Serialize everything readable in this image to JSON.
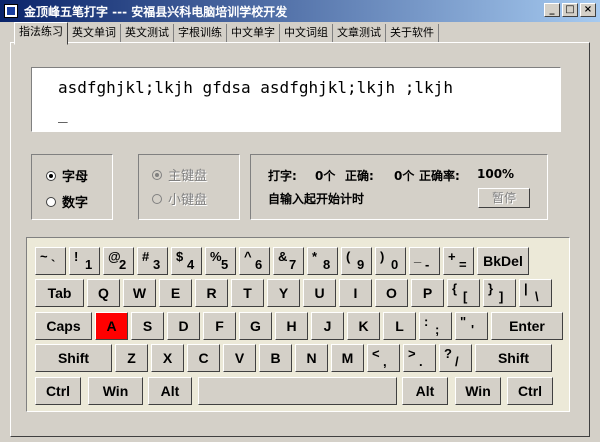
{
  "window": {
    "title": "金顶峰五笔打字 --- 安福县兴科电脑培训学校开发"
  },
  "tabs": [
    {
      "label": "指法练习",
      "active": true
    },
    {
      "label": "英文单词",
      "active": false
    },
    {
      "label": "英文测试",
      "active": false
    },
    {
      "label": "字根训练",
      "active": false
    },
    {
      "label": "中文单字",
      "active": false
    },
    {
      "label": "中文词组",
      "active": false
    },
    {
      "label": "文章测试",
      "active": false
    },
    {
      "label": "关于软件",
      "active": false
    }
  ],
  "practice": {
    "text": "asdfghjkl;lkjh gfdsa asdfghjkl;lkjh ;lkjh",
    "cursor": "_"
  },
  "mode": {
    "letters": "字母",
    "digits": "数字",
    "selected": "letters"
  },
  "keypad": {
    "main": "主键盘",
    "small": "小键盘"
  },
  "stats": {
    "typed_label": "打字:",
    "typed_value": "0个",
    "correct_label": "正确:",
    "correct_value": "0个",
    "rate_label": "正确率:",
    "rate_value": "100%",
    "auto_timer": "自输入起开始计时",
    "pause_label": "暂停"
  },
  "keyboard": {
    "highlight_color": "#ff0000",
    "rows": [
      [
        {
          "s": "~",
          "b": "`"
        },
        {
          "s": "!",
          "b": "1"
        },
        {
          "s": "@",
          "b": "2"
        },
        {
          "s": "#",
          "b": "3"
        },
        {
          "s": "$",
          "b": "4"
        },
        {
          "s": "%",
          "b": "5"
        },
        {
          "s": "^",
          "b": "6"
        },
        {
          "s": "&",
          "b": "7"
        },
        {
          "s": "*",
          "b": "8"
        },
        {
          "s": "(",
          "b": "9"
        },
        {
          "s": ")",
          "b": "0"
        },
        {
          "s": "_",
          "b": "-"
        },
        {
          "s": "+",
          "b": "="
        },
        {
          "c": "BkDel"
        }
      ],
      [
        {
          "c": "Tab"
        },
        {
          "c": "Q"
        },
        {
          "c": "W"
        },
        {
          "c": "E"
        },
        {
          "c": "R"
        },
        {
          "c": "T"
        },
        {
          "c": "Y"
        },
        {
          "c": "U"
        },
        {
          "c": "I"
        },
        {
          "c": "O"
        },
        {
          "c": "P"
        },
        {
          "s": "{",
          "b": "["
        },
        {
          "s": "}",
          "b": "]"
        },
        {
          "s": "|",
          "b": "\\"
        }
      ],
      [
        {
          "c": "Caps"
        },
        {
          "c": "A",
          "hl": true
        },
        {
          "c": "S"
        },
        {
          "c": "D"
        },
        {
          "c": "F"
        },
        {
          "c": "G"
        },
        {
          "c": "H"
        },
        {
          "c": "J"
        },
        {
          "c": "K"
        },
        {
          "c": "L"
        },
        {
          "s": ":",
          "b": ";"
        },
        {
          "s": "\"",
          "b": "'"
        },
        {
          "c": "Enter"
        }
      ],
      [
        {
          "c": "Shift"
        },
        {
          "c": "Z"
        },
        {
          "c": "X"
        },
        {
          "c": "C"
        },
        {
          "c": "V"
        },
        {
          "c": "B"
        },
        {
          "c": "N"
        },
        {
          "c": "M"
        },
        {
          "s": "<",
          "b": ","
        },
        {
          "s": ">",
          "b": "."
        },
        {
          "s": "?",
          "b": "/"
        },
        {
          "c": "Shift"
        }
      ],
      [
        {
          "c": "Ctrl"
        },
        {
          "c": "Win"
        },
        {
          "c": "Alt"
        },
        {
          "c": ""
        },
        {
          "c": "Alt"
        },
        {
          "c": "Win"
        },
        {
          "c": "Ctrl"
        }
      ]
    ]
  }
}
